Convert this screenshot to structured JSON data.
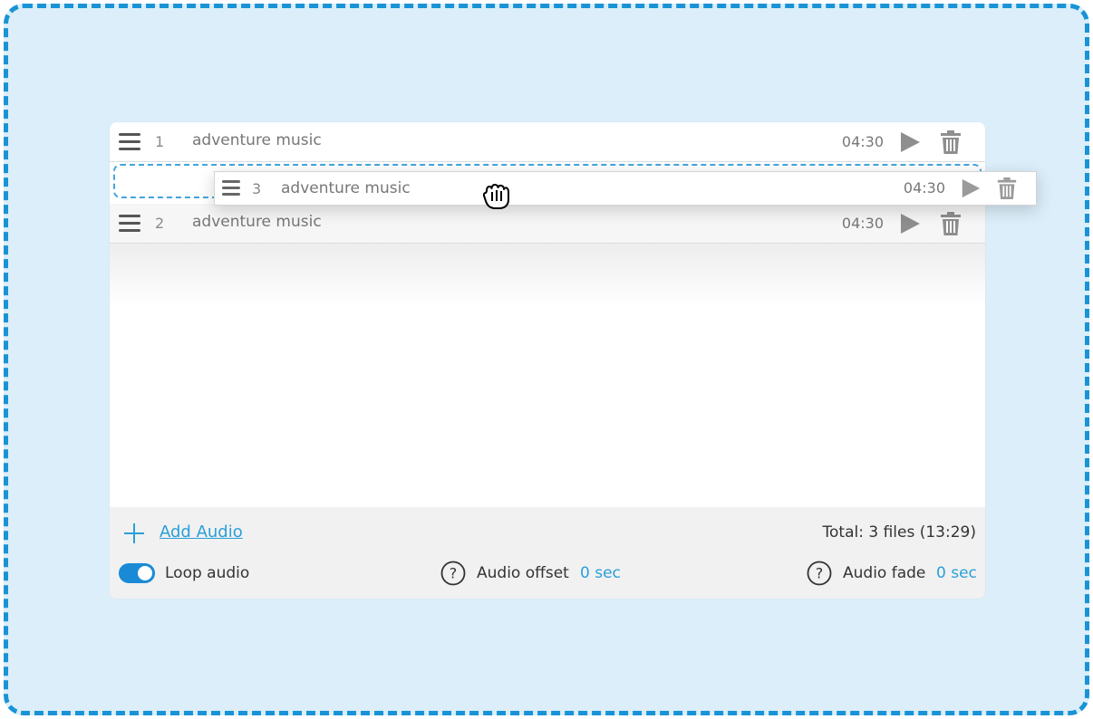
{
  "colors": {
    "frame_bg": "#dbeef9",
    "frame_border": "#1a93d6",
    "accent": "#2a9fd8",
    "toggle_on": "#1a8ad6"
  },
  "playlist": {
    "items": [
      {
        "index": "1",
        "title": "adventure music",
        "duration": "04:30"
      },
      {
        "index": "2",
        "title": "adventure music",
        "duration": "04:30"
      }
    ],
    "dragging": {
      "index": "3",
      "title": "adventure music",
      "duration": "04:30"
    }
  },
  "icons": {
    "drag_handle": "hamburger-icon",
    "play": "play-icon",
    "delete": "trash-icon",
    "add": "plus-icon",
    "help": "question-circle-icon",
    "cursor": "grab-hand-cursor-icon"
  },
  "footer": {
    "add_label": "Add Audio",
    "total": "Total: 3 files (13:29)",
    "loop_label": "Loop audio",
    "loop_enabled": true,
    "offset_label": "Audio offset",
    "offset_value": "0 sec",
    "fade_label": "Audio fade",
    "fade_value": "0 sec"
  }
}
